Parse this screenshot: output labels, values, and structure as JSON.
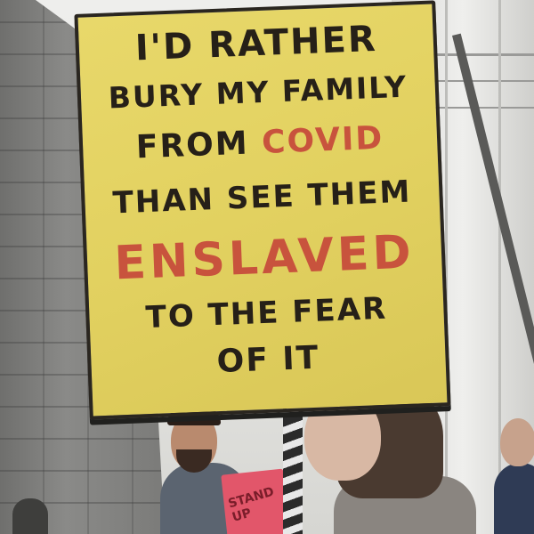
{
  "sign": {
    "lines": [
      {
        "text": "I'D RATHER",
        "color": "#262018"
      },
      {
        "text": "BURY MY FAMILY",
        "color": "#262018"
      },
      {
        "text_before": "FROM ",
        "text_highlight": "COVID",
        "color": "#262018",
        "highlight_color": "#c8533d"
      },
      {
        "text": "THAN SEE THEM",
        "color": "#262018"
      },
      {
        "text": "ENSLAVED",
        "color": "#c8533d"
      },
      {
        "text": "TO THE FEAR",
        "color": "#262018"
      },
      {
        "text": "OF IT",
        "color": "#262018"
      }
    ],
    "background_color": "#e2d160"
  },
  "small_sign": {
    "text": "STAND UP",
    "color": "#e2566a"
  }
}
